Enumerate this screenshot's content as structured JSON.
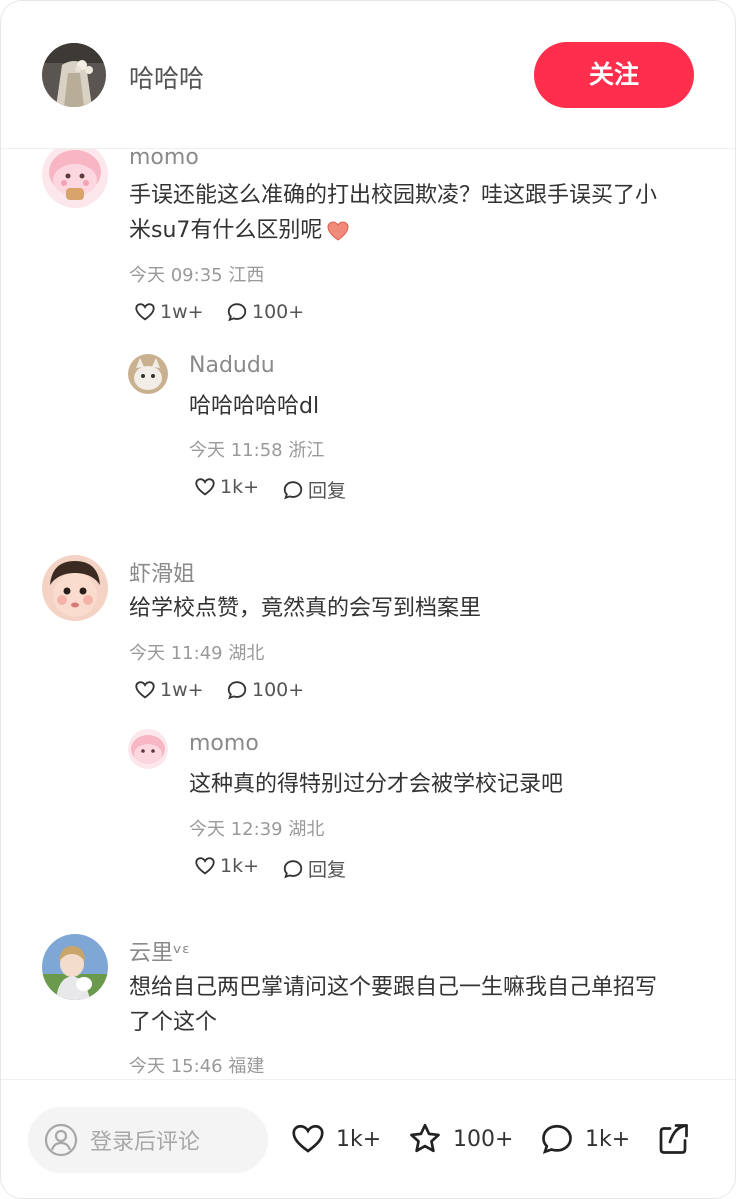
{
  "header": {
    "author_name": "哈哈哈",
    "follow_label": "关注"
  },
  "comments": [
    {
      "user": "momo",
      "text_line1": "手误还能这么准确的打出校园欺凌？哇这跟手误买了小",
      "text_line2": "米su7有什么区别呢",
      "time": "今天 09:35 江西",
      "likes": "1w+",
      "replies": "100+",
      "reply": {
        "user": "Nadudu",
        "text": "哈哈哈哈哈dl",
        "time": "今天 11:58 浙江",
        "likes": "1k+",
        "reply_label": "回复"
      }
    },
    {
      "user": "虾滑姐",
      "text": "给学校点赞，竟然真的会写到档案里",
      "time": "今天 11:49 湖北",
      "likes": "1w+",
      "replies": "100+",
      "reply": {
        "user": "momo",
        "text": "这种真的得特别过分才会被学校记录吧",
        "time": "今天 12:39 湖北",
        "likes": "1k+",
        "reply_label": "回复"
      }
    },
    {
      "user": "云里ᵛᵋ",
      "text_line1": "想给自己两巴掌请问这个要跟自己一生嘛我自己单招写",
      "text_line2": "了个这个",
      "time": "今天 15:46 福建"
    }
  ],
  "bottom_bar": {
    "input_placeholder": "登录后评论",
    "likes": "1k+",
    "favorites": "100+",
    "comments": "1k+"
  },
  "colors": {
    "accent": "#ff2e4d",
    "text": "#333333",
    "meta": "#9a9a9a"
  },
  "icons": [
    "heart-icon",
    "comment-icon",
    "star-icon",
    "share-icon",
    "user-icon",
    "red-heart-emoji"
  ]
}
